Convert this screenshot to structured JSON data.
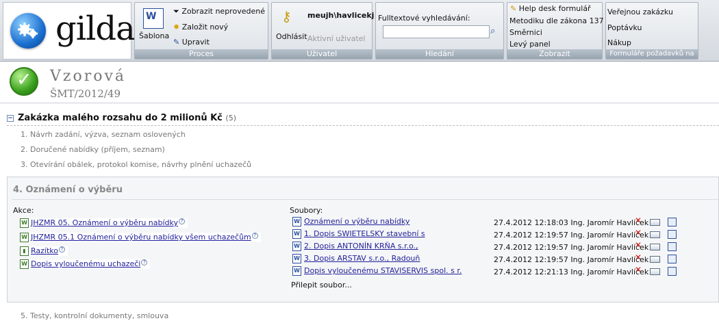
{
  "app": {
    "logo_text": "gilda"
  },
  "ribbon": {
    "proces": {
      "label": "Proces",
      "sablona": "Šablona",
      "zobrazit_neprovedene": "Zobrazit neprovedené",
      "zalozit_novy": "Založit nový",
      "upravit": "Upravit"
    },
    "uzivatel": {
      "label": "Uživatel",
      "username": "meujh\\havlicekj",
      "odhlasit": "Odhlásit",
      "aktivni": "Aktivní uživatel"
    },
    "hledani": {
      "label": "Hledání",
      "field_label": "Fulltextové vyhledávání:",
      "value": "",
      "placeholder": ""
    },
    "zobrazit": {
      "label": "Zobrazit",
      "items": [
        "Help desk formulář",
        "Metodiku dle zákona 137",
        "Směrnici",
        "Levý panel"
      ]
    },
    "formulare": {
      "label": "Formuláře požadavků na",
      "items": [
        "Veřejnou zakázku",
        "Poptávku",
        "Nákup"
      ]
    }
  },
  "header": {
    "title": "Vzorová",
    "subtitle": "ŠMT/2012/49"
  },
  "section1": {
    "title": "Zakázka malého rozsahu do 2 milionů Kč",
    "count": "(5)",
    "steps": [
      "1. Návrh zadání, výzva, seznam oslovených",
      "2. Doručené nabídky (příjem, seznam)",
      "3. Otevírání obálek, protokol komise, návrhy plnění uchazečů"
    ]
  },
  "section4": {
    "title": "4. Oznámení o výběru",
    "akce_label": "Akce:",
    "soubory_label": "Soubory:",
    "actions": [
      "JHZMR 05. Oznámení o výběru nabídky",
      "JHZMR 05.1 Oznámení o výběru nabídky všem uchazečům",
      "Razítko",
      "Dopis vyloučenému uchazeči"
    ],
    "files": [
      {
        "name": "Oznámení o výběru nabídky",
        "date": "27.4.2012 12:18:03",
        "author": "Ing. Jaromír Havlíček"
      },
      {
        "name": "1. Dopis SWIETELSKY stavební s",
        "date": "27.4.2012 12:19:57",
        "author": "Ing. Jaromír Havlíček"
      },
      {
        "name": "2. Dopis ANTONÍN KRŇA s.r.o.,",
        "date": "27.4.2012 12:19:57",
        "author": "Ing. Jaromír Havlíček"
      },
      {
        "name": "3. Dopis ARSTAV s.r.o., Radouň",
        "date": "27.4.2012 12:19:57",
        "author": "Ing. Jaromír Havlíček"
      },
      {
        "name": "Dopis vyloučenému STAVISERVIS spol. s r.",
        "date": "27.4.2012 12:21:13",
        "author": "Ing. Jaromír Havlíček"
      }
    ],
    "paste_label": "Přilepit soubor..."
  },
  "step5": "5. Testy, kontrolní dokumenty, smlouva"
}
